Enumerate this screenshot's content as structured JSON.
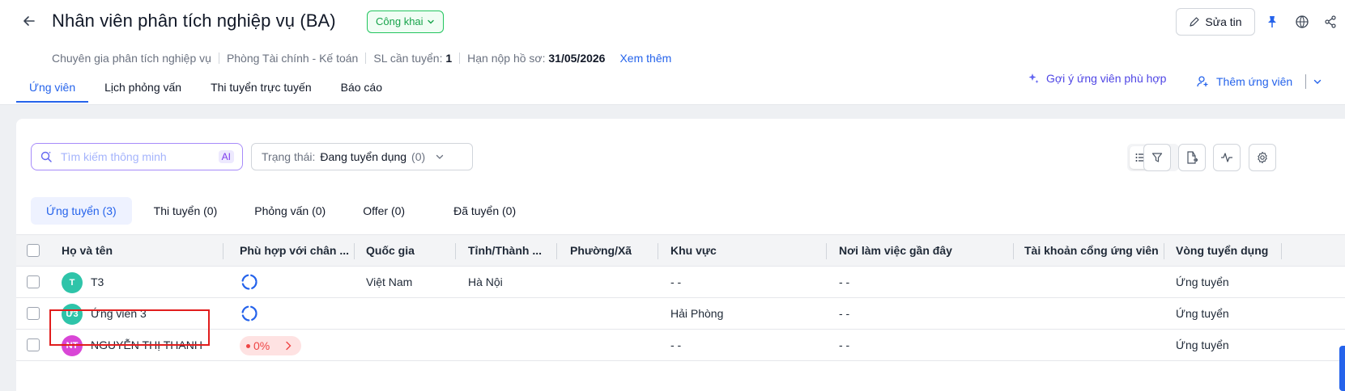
{
  "header": {
    "title": "Nhân viên phân tích nghiệp vụ (BA)",
    "visibility": "Công khai",
    "meta": {
      "position": "Chuyên gia phân tích nghiệp vụ",
      "department": "Phòng Tài chính - Kế toán",
      "quantity_label": "SL cần tuyển:",
      "quantity": "1",
      "deadline_label": "Hạn nộp hồ sơ:",
      "deadline": "31/05/2026",
      "more": "Xem thêm"
    },
    "edit_label": "Sửa tin",
    "icons": [
      "pin-icon",
      "globe-icon",
      "share-icon"
    ]
  },
  "tabs": [
    {
      "label": "Ứng viên",
      "active": true
    },
    {
      "label": "Lịch phỏng vấn",
      "active": false
    },
    {
      "label": "Thi tuyển trực tuyến",
      "active": false
    },
    {
      "label": "Báo cáo",
      "active": false
    }
  ],
  "actions": {
    "suggest": "Gợi ý ứng viên phù hợp",
    "add_candidate": "Thêm ứng viên"
  },
  "toolbar": {
    "search_placeholder": "Tìm kiếm thông minh",
    "ai_badge": "AI",
    "status_label": "Trạng thái:",
    "status_value": "Đang tuyển dụng",
    "status_count": "(0)"
  },
  "stages": [
    {
      "label": "Ứng tuyển (3)",
      "active": true
    },
    {
      "label": "Thi tuyển (0)",
      "active": false
    },
    {
      "label": "Phỏng vấn (0)",
      "active": false
    },
    {
      "label": "Offer (0)",
      "active": false
    },
    {
      "label": "Đã tuyển (0)",
      "active": false
    }
  ],
  "table": {
    "columns": [
      "Họ và tên",
      "Phù hợp với chân ...",
      "Quốc gia",
      "Tỉnh/Thành ...",
      "Phường/Xã",
      "Khu vực",
      "Nơi làm việc gần đây",
      "Tài khoản cổng ứng viên",
      "Vòng tuyển dụng"
    ],
    "rows": [
      {
        "initials": "T",
        "avatar_color": "#2ec4a9",
        "name": "T3",
        "match": "loading",
        "country": "Việt Nam",
        "province": "Hà Nội",
        "ward": "",
        "region": "- -",
        "recent_work": "- -",
        "portal": "",
        "round": "Ứng tuyển"
      },
      {
        "initials": "Ư3",
        "avatar_color": "#2ec4a9",
        "name": "Ứng viên 3",
        "match": "loading",
        "country": "",
        "province": "",
        "ward": "",
        "region": "Hải Phòng",
        "recent_work": "- -",
        "portal": "",
        "round": "Ứng tuyển"
      },
      {
        "initials": "NT",
        "avatar_color": "#d946d6",
        "name": "NGUYỄN THỊ THANH",
        "match": "0%",
        "country": "",
        "province": "",
        "ward": "",
        "region": "- -",
        "recent_work": "- -",
        "portal": "",
        "round": "Ứng tuyển"
      }
    ]
  },
  "colors": {
    "accent": "#2563eb",
    "public_green": "#16a34a",
    "highlight_red": "#e11d1d"
  }
}
